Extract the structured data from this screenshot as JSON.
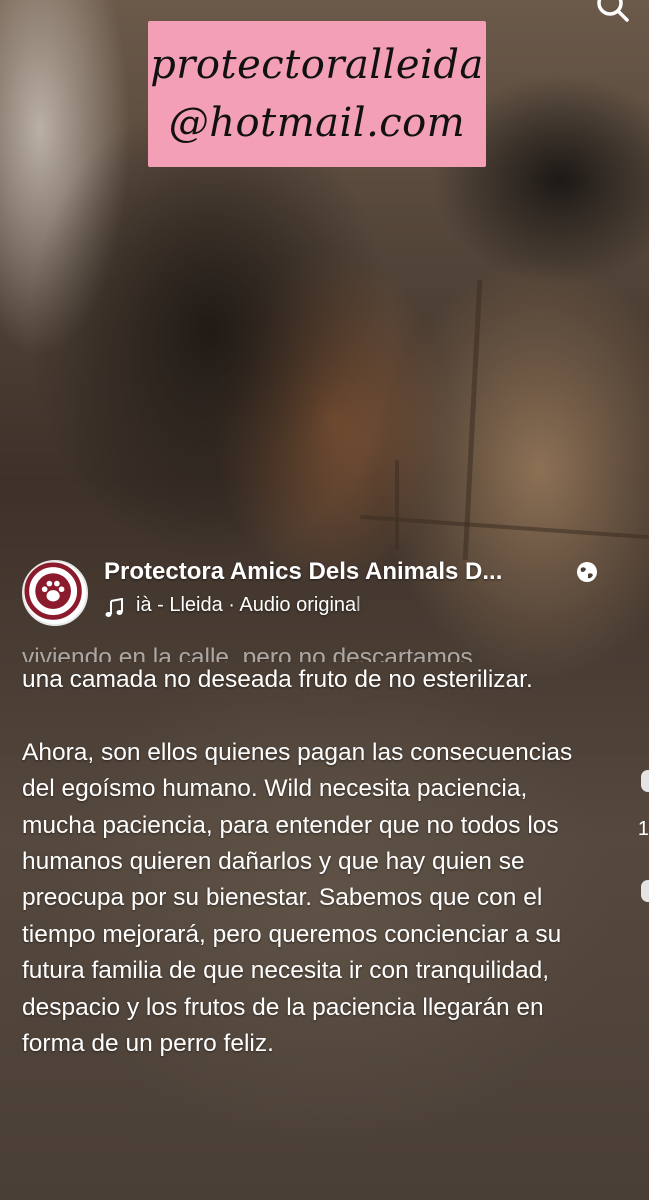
{
  "email_tag": {
    "line1": "protectoralleida",
    "line2": "@hotmail.com"
  },
  "post": {
    "author_name": "Protectora Amics Dels Animals D...",
    "audio_prefix": "ià - Lleida · ",
    "audio_label": "Audio origina",
    "audio_tail": "l"
  },
  "caption": {
    "partial_line": "viviendo en la calle, pero no descartamos",
    "para1": "una camada no deseada fruto de no esterilizar.",
    "para2": "Ahora, son ellos quienes pagan las consecuencias del egoísmo humano. Wild necesita paciencia, mucha paciencia, para entender que no todos los humanos quieren dañarlos y que hay quien se preocupa por su bienestar. Sabemos que con el tiempo mejorará, pero queremos concienciar a su futura familia de que necesita ir con tranquilidad, despacio y los frutos de la paciencia llegarán en forma de un perro feliz."
  },
  "side": {
    "count_hint": "1"
  },
  "icons": {
    "search": "search-icon",
    "globe": "globe-icon",
    "music": "music-note-icon",
    "avatar": "paw-logo-icon"
  },
  "colors": {
    "email_tag_bg": "#f39fb6",
    "avatar_logo": "#8b1a2c"
  }
}
